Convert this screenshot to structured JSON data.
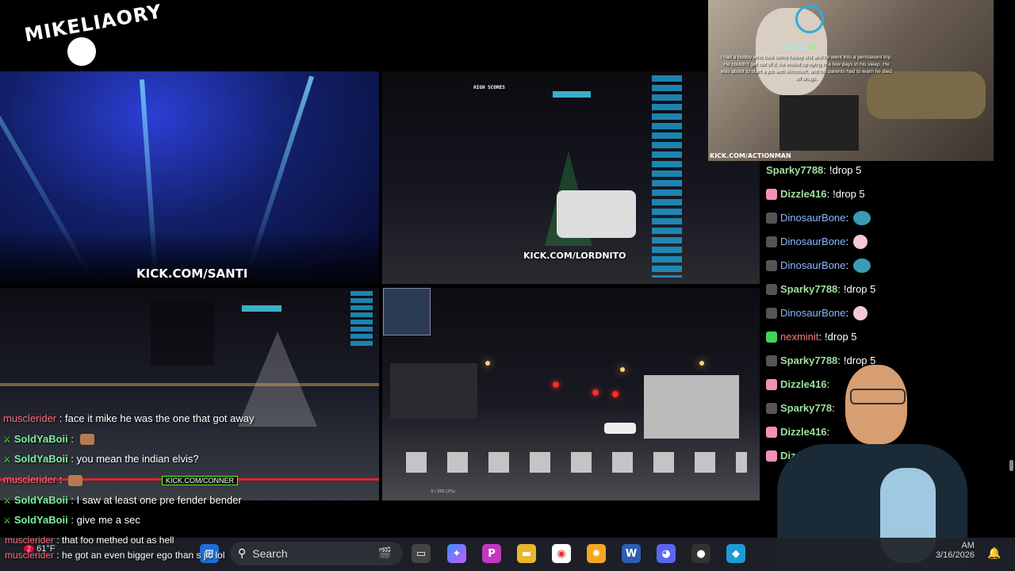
{
  "logo": {
    "text": "MIKELIAORY"
  },
  "panels": {
    "club_tag": "KICK.COM/SANTI",
    "drive1_tag": "KICK.COM/LORDNITO",
    "drive2_scores_title": "HIGH SCORES",
    "drive3_progress": "3 / 200 (2%)"
  },
  "overlay_chat": [
    {
      "user": "musclerider",
      "user_color": "red",
      "sep": " : ",
      "message": "face it mike he was the one that got away",
      "badge": false
    },
    {
      "user": "SoldYaBoii",
      "user_color": "green",
      "sep": " : ",
      "message": "",
      "badge": true,
      "emote": true
    },
    {
      "user": "SoldYaBoii",
      "user_color": "green",
      "sep": " : ",
      "message": "you mean the indian elvis?",
      "badge": true
    },
    {
      "user": "musclerider",
      "user_color": "red",
      "sep": " : ",
      "message": "",
      "badge": false,
      "emote": true,
      "tag": "KICK.COM/CONNER"
    },
    {
      "user": "SoldYaBoii",
      "user_color": "green",
      "sep": " : ",
      "message": "I saw at least one pre fender bender",
      "badge": true
    },
    {
      "user": "SoldYaBoii",
      "user_color": "green",
      "sep": " : ",
      "message": "give me a sec",
      "badge": true
    }
  ],
  "overlay_bottom": [
    {
      "user": "musclerider",
      "message": "that foo methed out as hell"
    },
    {
      "user": "musclerider",
      "message": "he got an even bigger ego than s jic lol"
    }
  ],
  "right_chat": [
    {
      "user": "Sparky7788",
      "color": "green",
      "badge": "none",
      "message": "!drop 5",
      "emote": ""
    },
    {
      "user": "Dizzle416",
      "color": "green",
      "badge": "gift",
      "message": "!drop 5",
      "emote": ""
    },
    {
      "user": "DinosaurBone",
      "color": "blue",
      "badge": "ninja",
      "message": "",
      "emote": "blue"
    },
    {
      "user": "DinosaurBone",
      "color": "blue",
      "badge": "ninja",
      "message": "",
      "emote": "pig"
    },
    {
      "user": "DinosaurBone",
      "color": "blue",
      "badge": "ninja",
      "message": "",
      "emote": "blue"
    },
    {
      "user": "Sparky7788",
      "color": "green",
      "badge": "ninja",
      "message": "!drop 5",
      "emote": ""
    },
    {
      "user": "DinosaurBone",
      "color": "blue",
      "badge": "ninja",
      "message": "",
      "emote": "pig"
    },
    {
      "user": "nexminit",
      "color": "red",
      "badge": "green",
      "message": "!drop 5",
      "emote": ""
    },
    {
      "user": "Sparky7788",
      "color": "green",
      "badge": "ninja",
      "message": "!drop 5",
      "emote": ""
    },
    {
      "user": "Dizzle416",
      "color": "green",
      "badge": "gift",
      "message": "",
      "emote": ""
    },
    {
      "user": "Sparky778",
      "color": "green",
      "badge": "ninja",
      "message": "",
      "emote": ""
    },
    {
      "user": "Dizzle416",
      "color": "green",
      "badge": "gift",
      "message": "",
      "emote": ""
    },
    {
      "user": "Diz",
      "color": "green",
      "badge": "gift",
      "message": "",
      "emote": ""
    }
  ],
  "cam": {
    "user": "slgRay",
    "amount": "$3",
    "caption": "i had a buddy who took some heavy shit and he went into a permanent trip. He couldn't get out of it, he ended up dying in a few days in his sleep. He was about to start a job with Microsoft, and his parents had to learn he died off drugs.",
    "kick_tag": "KICK.COM/ACTIONMAN"
  },
  "taskbar": {
    "search_placeholder": "Search",
    "weather": "61°F",
    "weather_badge": "2",
    "time": "AM",
    "date": "3/16/2026"
  }
}
